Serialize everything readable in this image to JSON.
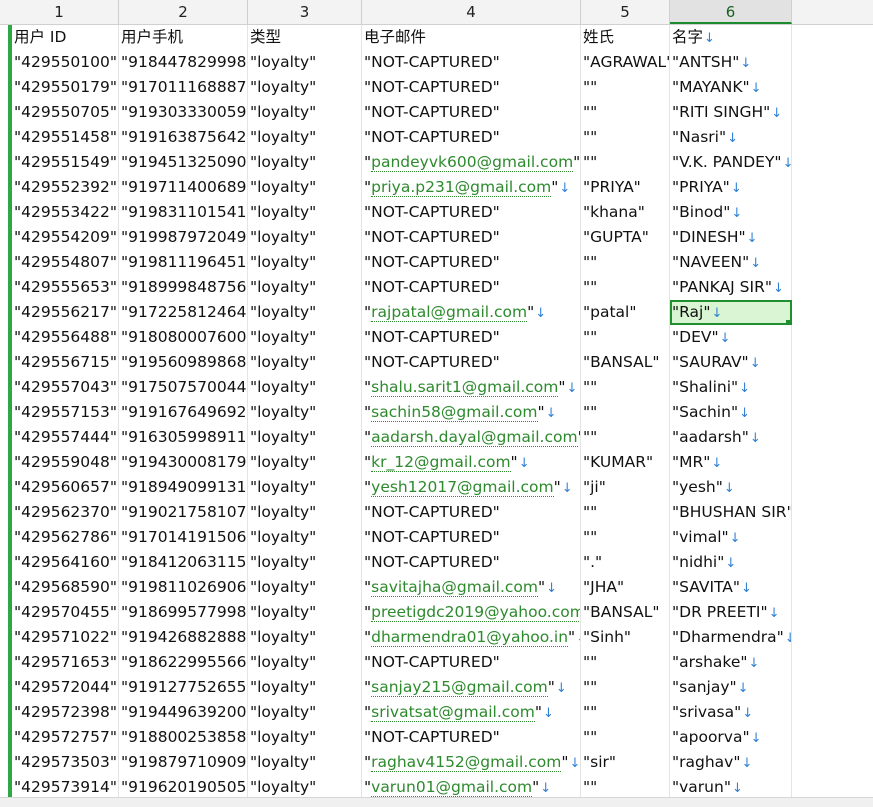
{
  "columns": [
    "1",
    "2",
    "3",
    "4",
    "5",
    "6"
  ],
  "active_column": "6",
  "header_row": [
    "用户 ID",
    "用户手机",
    "类型",
    "电子邮件",
    "姓氏",
    "名字"
  ],
  "rows": [
    [
      "\"429550100\"",
      "\"918447829998\"",
      "\"loyalty\"",
      "\"NOT-CAPTURED\"",
      "\"AGRAWAL\"",
      "\"ANTSH\""
    ],
    [
      "\"429550179\"",
      "\"917011168887\"",
      "\"loyalty\"",
      "\"NOT-CAPTURED\"",
      "\"\"",
      "\"MAYANK\""
    ],
    [
      "\"429550705\"",
      "\"919303330059\"",
      "\"loyalty\"",
      "\"NOT-CAPTURED\"",
      "\"\"",
      "\"RITI SINGH\""
    ],
    [
      "\"429551458\"",
      "\"919163875642\"",
      "\"loyalty\"",
      "\"NOT-CAPTURED\"",
      "\"\"",
      "\"Nasri\""
    ],
    [
      "\"429551549\"",
      "\"919451325090\"",
      "\"loyalty\"",
      "\"pandeyvk600@gmail.com\"",
      "\"\"",
      "\"V.K. PANDEY\""
    ],
    [
      "\"429552392\"",
      "\"919711400689\"",
      "\"loyalty\"",
      "\"priya.p231@gmail.com\"",
      "\"PRIYA\"",
      "\"PRIYA\""
    ],
    [
      "\"429553422\"",
      "\"919831101541\"",
      "\"loyalty\"",
      "\"NOT-CAPTURED\"",
      "\"khana\"",
      "\"Binod\""
    ],
    [
      "\"429554209\"",
      "\"919987972049\"",
      "\"loyalty\"",
      "\"NOT-CAPTURED\"",
      "\"GUPTA\"",
      "\"DINESH\""
    ],
    [
      "\"429554807\"",
      "\"919811196451\"",
      "\"loyalty\"",
      "\"NOT-CAPTURED\"",
      "\"\"",
      "\"NAVEEN\""
    ],
    [
      "\"429555653\"",
      "\"918999848756\"",
      "\"loyalty\"",
      "\"NOT-CAPTURED\"",
      "\"\"",
      "\"PANKAJ SIR\""
    ],
    [
      "\"429556217\"",
      "\"917225812464\"",
      "\"loyalty\"",
      "\"rajpatal@gmail.com\"",
      "\"patal\"",
      "\"Raj\""
    ],
    [
      "\"429556488\"",
      "\"918080007600\"",
      "\"loyalty\"",
      "\"NOT-CAPTURED\"",
      "\"\"",
      "\"DEV\""
    ],
    [
      "\"429556715\"",
      "\"919560989868\"",
      "\"loyalty\"",
      "\"NOT-CAPTURED\"",
      "\"BANSAL\"",
      "\"SAURAV\""
    ],
    [
      "\"429557043\"",
      "\"917507570044\"",
      "\"loyalty\"",
      "\"shalu.sarit1@gmail.com\"",
      "\"\"",
      "\"Shalini\""
    ],
    [
      "\"429557153\"",
      "\"919167649692\"",
      "\"loyalty\"",
      "\"sachin58@gmail.com\"",
      "\"\"",
      "\"Sachin\""
    ],
    [
      "\"429557444\"",
      "\"916305998911\"",
      "\"loyalty\"",
      "\"aadarsh.dayal@gmail.com\"",
      "\"\"",
      "\"aadarsh\""
    ],
    [
      "\"429559048\"",
      "\"919430008179\"",
      "\"loyalty\"",
      "\"kr_12@gmail.com\"",
      "\"KUMAR\"",
      "\"MR\""
    ],
    [
      "\"429560657\"",
      "\"918949099131\"",
      "\"loyalty\"",
      "\"yesh12017@gmail.com\"",
      "\"ji\"",
      "\"yesh\""
    ],
    [
      "\"429562370\"",
      "\"919021758107\"",
      "\"loyalty\"",
      "\"NOT-CAPTURED\"",
      "\"\"",
      "\"BHUSHAN SIR\""
    ],
    [
      "\"429562786\"",
      "\"917014191506\"",
      "\"loyalty\"",
      "\"NOT-CAPTURED\"",
      "\"\"",
      "\"vimal\""
    ],
    [
      "\"429564160\"",
      "\"918412063115\"",
      "\"loyalty\"",
      "\"NOT-CAPTURED\"",
      "\".\"",
      "\"nidhi\""
    ],
    [
      "\"429568590\"",
      "\"919811026906\"",
      "\"loyalty\"",
      "\"savitajha@gmail.com\"",
      "\"JHA\"",
      "\"SAVITA\""
    ],
    [
      "\"429570455\"",
      "\"918699577998\"",
      "\"loyalty\"",
      "\"preetigdc2019@yahoo.com\"",
      "\"BANSAL\"",
      "\"DR PREETI\""
    ],
    [
      "\"429571022\"",
      "\"919426882888\"",
      "\"loyalty\"",
      "\"dharmendra01@yahoo.in\"",
      "\"Sinh\"",
      "\"Dharmendra\""
    ],
    [
      "\"429571653\"",
      "\"918622995566\"",
      "\"loyalty\"",
      "\"NOT-CAPTURED\"",
      "\"\"",
      "\"arshake\""
    ],
    [
      "\"429572044\"",
      "\"919127752655\"",
      "\"loyalty\"",
      "\"sanjay215@gmail.com\"",
      "\"\"",
      "\"sanjay\""
    ],
    [
      "\"429572398\"",
      "\"919449639200\"",
      "\"loyalty\"",
      "\"srivatsat@gmail.com\"",
      "\"\"",
      "\"srivasa\""
    ],
    [
      "\"429572757\"",
      "\"918800253858\"",
      "\"loyalty\"",
      "\"NOT-CAPTURED\"",
      "\"\"",
      "\"apoorva\""
    ],
    [
      "\"429573503\"",
      "\"919879710909\"",
      "\"loyalty\"",
      "\"raghav4152@gmail.com\"",
      "\"sir\"",
      "\"raghav\""
    ],
    [
      "\"429573914\"",
      "\"919620190505\"",
      "\"loyalty\"",
      "\"varun01@gmail.com\"",
      "\"\"",
      "\"varun\""
    ]
  ],
  "selected_cell": {
    "row": 10,
    "col": 5
  },
  "colors": {
    "accent": "#1f8f2f",
    "email": "#2d8a2d",
    "arrow": "#2e7fd6",
    "selected_bg": "#d9f5d3"
  },
  "icons": {
    "line_break_marker": "down-arrow-icon"
  }
}
